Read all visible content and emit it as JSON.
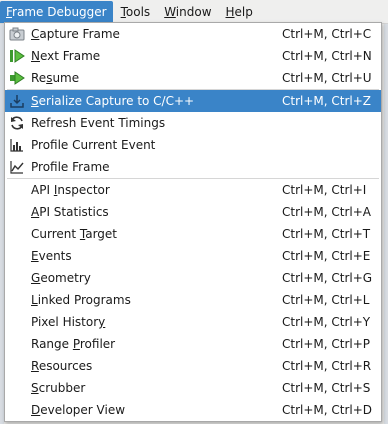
{
  "menubar": {
    "items": [
      {
        "pre": "",
        "u": "F",
        "post": "rame Debugger"
      },
      {
        "pre": "",
        "u": "T",
        "post": "ools"
      },
      {
        "pre": "",
        "u": "W",
        "post": "indow"
      },
      {
        "pre": "",
        "u": "H",
        "post": "elp"
      }
    ]
  },
  "menu": {
    "group1": [
      {
        "pre": "",
        "u": "C",
        "post": "apture Frame",
        "shortcut": "Ctrl+M, Ctrl+C",
        "icon": "camera-icon"
      },
      {
        "pre": "",
        "u": "N",
        "post": "ext Frame",
        "shortcut": "Ctrl+M, Ctrl+N",
        "icon": "next-frame-icon"
      },
      {
        "pre": "Re",
        "u": "s",
        "post": "ume",
        "shortcut": "Ctrl+M, Ctrl+U",
        "icon": "resume-icon"
      }
    ],
    "group2": [
      {
        "pre": "",
        "u": "S",
        "post": "erialize Capture to C/C++",
        "shortcut": "Ctrl+M, Ctrl+Z",
        "icon": "serialize-icon"
      },
      {
        "pre": "Refresh Event Timings",
        "u": "",
        "post": "",
        "shortcut": "",
        "icon": "refresh-icon"
      },
      {
        "pre": "Profile Current Event",
        "u": "",
        "post": "",
        "shortcut": "",
        "icon": "bar-chart-icon"
      },
      {
        "pre": "Profile Frame",
        "u": "",
        "post": "",
        "shortcut": "",
        "icon": "area-chart-icon"
      }
    ],
    "group3": [
      {
        "pre": "API ",
        "u": "I",
        "post": "nspector",
        "shortcut": "Ctrl+M, Ctrl+I"
      },
      {
        "pre": "",
        "u": "A",
        "post": "PI Statistics",
        "shortcut": "Ctrl+M, Ctrl+A"
      },
      {
        "pre": "Current ",
        "u": "T",
        "post": "arget",
        "shortcut": "Ctrl+M, Ctrl+T"
      },
      {
        "pre": "",
        "u": "E",
        "post": "vents",
        "shortcut": "Ctrl+M, Ctrl+E"
      },
      {
        "pre": "",
        "u": "G",
        "post": "eometry",
        "shortcut": "Ctrl+M, Ctrl+G"
      },
      {
        "pre": "",
        "u": "L",
        "post": "inked Programs",
        "shortcut": "Ctrl+M, Ctrl+L"
      },
      {
        "pre": "Pixel Histor",
        "u": "y",
        "post": "",
        "shortcut": "Ctrl+M, Ctrl+Y"
      },
      {
        "pre": "Range ",
        "u": "P",
        "post": "rofiler",
        "shortcut": "Ctrl+M, Ctrl+P"
      },
      {
        "pre": "",
        "u": "R",
        "post": "esources",
        "shortcut": "Ctrl+M, Ctrl+R"
      },
      {
        "pre": "",
        "u": "S",
        "post": "crubber",
        "shortcut": "Ctrl+M, Ctrl+S"
      },
      {
        "pre": "",
        "u": "D",
        "post": "eveloper View",
        "shortcut": "Ctrl+M, Ctrl+D"
      }
    ]
  },
  "colors": {
    "selection": "#3a84c8",
    "menu_bg": "#ffffff"
  }
}
